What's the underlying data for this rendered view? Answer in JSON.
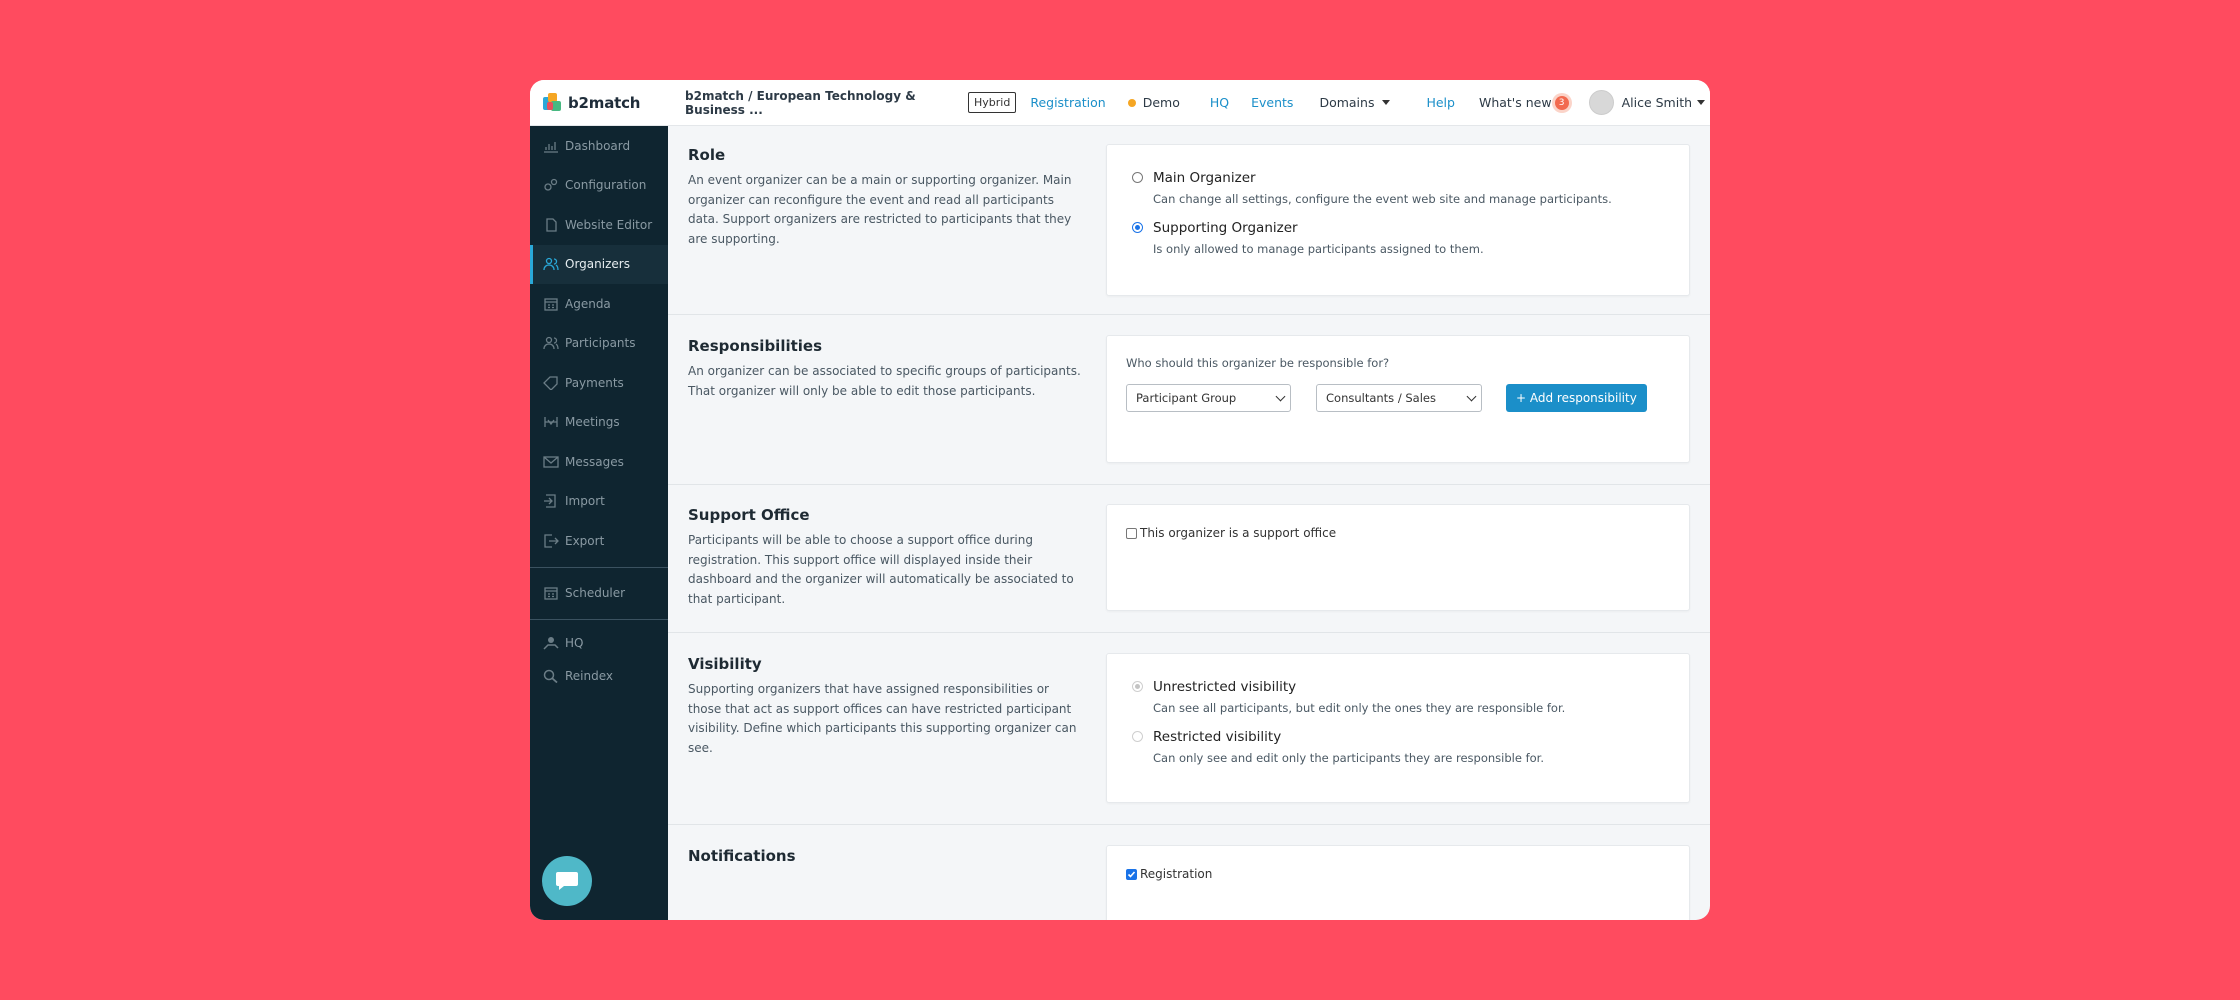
{
  "app": {
    "logo_text": "b2match"
  },
  "topbar": {
    "breadcrumb": "b2match / European Technology & Business ...",
    "badge": "Hybrid",
    "registration": "Registration",
    "demo": "Demo",
    "hq": "HQ",
    "events": "Events",
    "domains": "Domains",
    "help": "Help",
    "whats_new": "What's new",
    "whats_new_count": "3",
    "user_name": "Alice Smith"
  },
  "sidebar": {
    "items": [
      {
        "label": "Dashboard",
        "icon": "chart-icon"
      },
      {
        "label": "Configuration",
        "icon": "gears-icon"
      },
      {
        "label": "Website Editor",
        "icon": "document-icon"
      },
      {
        "label": "Organizers",
        "icon": "users-icon",
        "active": true
      },
      {
        "label": "Agenda",
        "icon": "calendar-icon"
      },
      {
        "label": "Participants",
        "icon": "participants-icon"
      },
      {
        "label": "Payments",
        "icon": "tag-icon"
      },
      {
        "label": "Meetings",
        "icon": "handshake-icon"
      },
      {
        "label": "Messages",
        "icon": "envelope-icon"
      },
      {
        "label": "Import",
        "icon": "import-icon"
      },
      {
        "label": "Export",
        "icon": "export-icon"
      },
      {
        "label": "Scheduler",
        "icon": "calendar-icon"
      },
      {
        "label": "HQ",
        "icon": "hq-icon"
      },
      {
        "label": "Reindex",
        "icon": "search-icon"
      }
    ]
  },
  "sections": {
    "role": {
      "title": "Role",
      "description": "An event organizer can be a main or supporting organizer. Main organizer can reconfigure the event and read all participants data. Support organizers are restricted to participants that they are supporting.",
      "options": [
        {
          "label": "Main Organizer",
          "help": "Can change all settings, configure the event web site and manage participants.",
          "checked": false
        },
        {
          "label": "Supporting Organizer",
          "help": "Is only allowed to manage participants assigned to them.",
          "checked": true
        }
      ]
    },
    "responsibilities": {
      "title": "Responsibilities",
      "description": "An organizer can be associated to specific groups of participants. That organizer will only be able to edit those participants.",
      "question": "Who should this organizer be responsible for?",
      "select_type": "Participant Group",
      "select_group": "Consultants / Sales",
      "add_button": "+ Add responsibility"
    },
    "support_office": {
      "title": "Support Office",
      "description": "Participants will be able to choose a support office during registration. This support office will displayed inside their dashboard and the organizer will automatically be associated to that participant.",
      "checkbox_label": "This organizer is a support office",
      "checked": false
    },
    "visibility": {
      "title": "Visibility",
      "description": "Supporting organizers that have assigned responsibilities or those that act as support offices can have restricted participant visibility. Define which participants this supporting organizer can see.",
      "options": [
        {
          "label": "Unrestricted visibility",
          "help": "Can see all participants, but edit only the ones they are responsible for.",
          "checked": true
        },
        {
          "label": "Restricted visibility",
          "help": "Can only see and edit only the participants they are responsible for.",
          "checked": false
        }
      ]
    },
    "notifications": {
      "title": "Notifications",
      "checkbox_label": "Registration",
      "checked": true
    }
  },
  "colors": {
    "background": "#ff4b5f",
    "sidebar": "#0f2530",
    "accent": "#1b8fc9"
  }
}
